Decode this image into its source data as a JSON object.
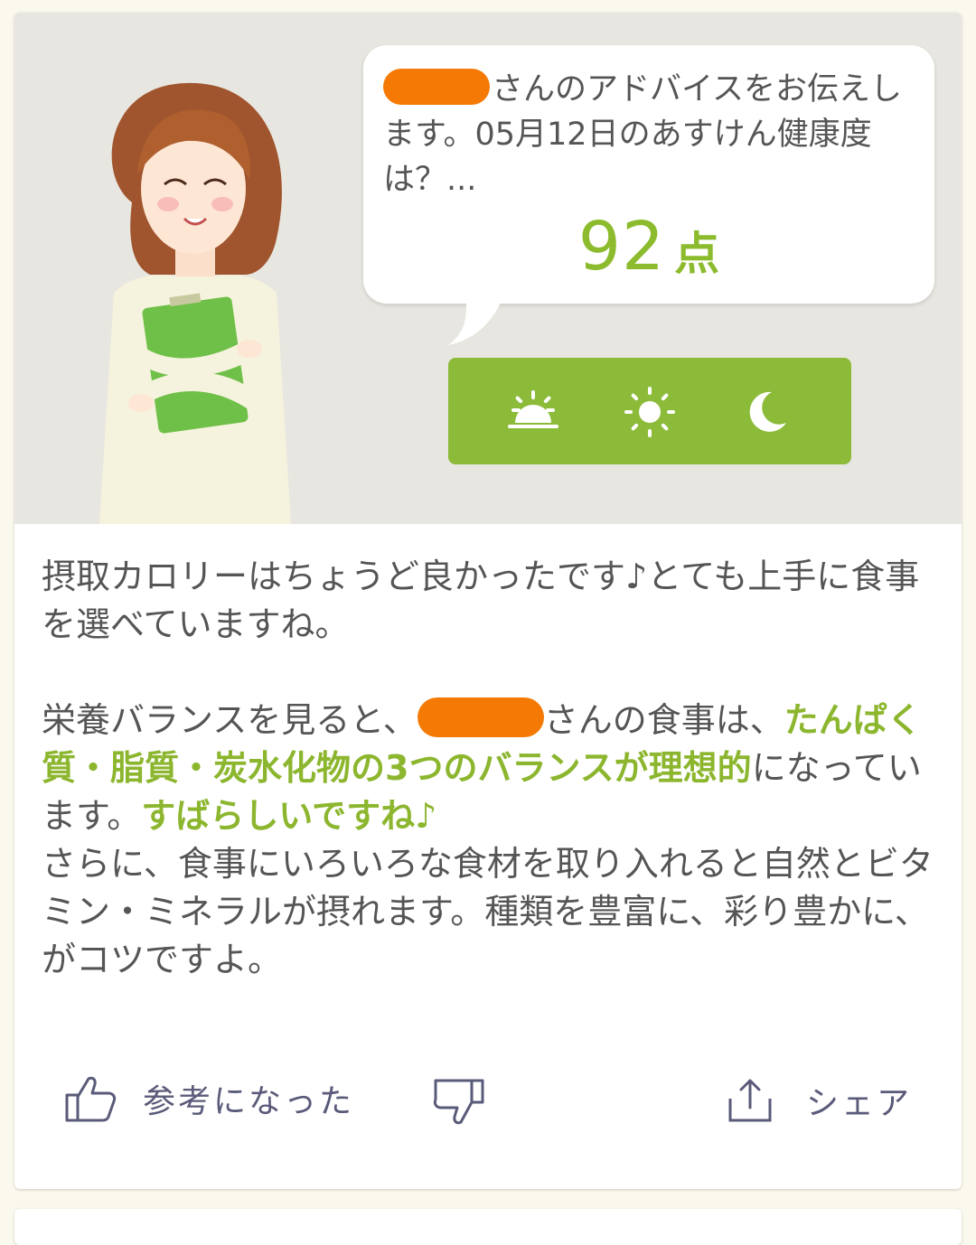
{
  "advice": {
    "intro_suffix": "さんのアドバイスをお伝えします。05月12日のあすけん健康度は？...",
    "score_value": "92",
    "score_unit": "点"
  },
  "time_tabs": [
    {
      "name": "morning",
      "icon": "sunrise-icon"
    },
    {
      "name": "daytime",
      "icon": "sun-icon"
    },
    {
      "name": "night",
      "icon": "moon-icon"
    }
  ],
  "body": {
    "p1": "摂取カロリーはちょうど良かったです♪とても上手に食事を選べていますね。",
    "p2_a": "栄養バランスを見ると、",
    "p2_b": "さんの食事は、",
    "p2_green1": "たんぱく質・脂質・炭水化物の3つのバランスが理想的",
    "p2_c": "になっています。",
    "p2_green2": "すばらしいですね♪",
    "p3": "さらに、食事にいろいろな食材を取り入れると自然とビタミン・ミネラルが摂れます。種類を豊富に、彩り豊かに、がコツですよ。"
  },
  "actions": {
    "helpful_label": "参考になった",
    "share_label": "シェア"
  },
  "colors": {
    "accent_green": "#8cbb2e",
    "redaction": "#f47a05",
    "hero_bg": "#e8e6e0"
  }
}
